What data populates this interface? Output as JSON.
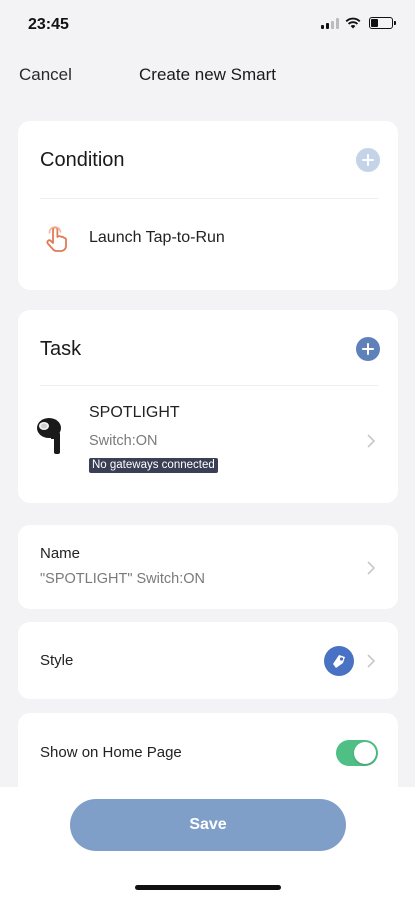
{
  "status_bar": {
    "time": "23:45",
    "icons": [
      "signal-icon",
      "wifi-icon",
      "battery-icon"
    ],
    "battery_level": 0.35
  },
  "nav": {
    "cancel_label": "Cancel",
    "title": "Create new Smart"
  },
  "condition": {
    "title": "Condition",
    "add_icon": "add-circle-icon",
    "add_color": "#c4d3e6",
    "item": {
      "icon": "tap-hand-icon",
      "icon_color": "#e07a55",
      "label": "Launch Tap-to-Run"
    }
  },
  "task": {
    "title": "Task",
    "add_icon": "add-circle-icon",
    "add_color": "#5f80b8",
    "item": {
      "icon": "spotlight-device-icon",
      "name": "SPOTLIGHT",
      "status": "Switch:ON",
      "badge": "No gateways connected"
    }
  },
  "name_row": {
    "label": "Name",
    "value": "\"SPOTLIGHT\" Switch:ON"
  },
  "style_row": {
    "label": "Style",
    "icon": "style-tag-icon",
    "icon_color": "#4a72c4"
  },
  "home_row": {
    "label": "Show on Home Page",
    "toggle_on": true,
    "toggle_color": "#4fbf86"
  },
  "save": {
    "label": "Save",
    "color": "#7f9fc8"
  }
}
